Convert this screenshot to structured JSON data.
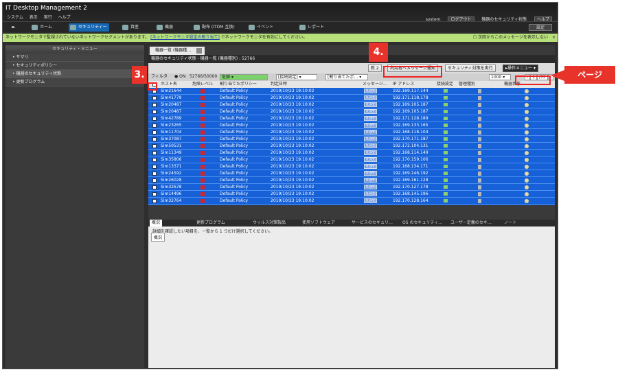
{
  "app": {
    "title": "IT Desktop Management 2",
    "menu": [
      "システム",
      "表示",
      "実行",
      "ヘルプ"
    ]
  },
  "topright": {
    "user": "system",
    "logout": "ログアウト",
    "status": "機器のセキュリティ状態",
    "help": "ヘルプ",
    "settings": "設定"
  },
  "nav": [
    "ホーム",
    "セキュリティー",
    "資産",
    "機器",
    "配布 (ITDM 互換)",
    "イベント",
    "レポート"
  ],
  "notice": {
    "text": "ネットワークモニタで監視されていないネットワークセグメントがあります。",
    "link": "[ネットワークモニタ設定の割り当て]",
    "tail": "でネットワークモニタを有効にしてください。",
    "checkbox": "次回からこのメッセージを表示しない",
    "close": "×"
  },
  "sidebar": {
    "title": "セキュリティ・メニュー",
    "items": [
      "サマリ",
      "セキュリティポリシー",
      "機器のセキュリティ状態",
      "更新プログラム"
    ]
  },
  "main": {
    "tab": "機器一覧 (機器種…",
    "breadcrumb": "機器のセキュリティ状態 - 機器一覧 (機器種別) : 52766",
    "toolbar": {
      "send_message": "利用者へメッセージ通知",
      "run_security": "セキュリティ対策を実行",
      "ops_menu": "操作メニュー",
      "cut": "新 2"
    },
    "filter": {
      "label": "フィルタ",
      "on": "ON",
      "count": "52766/50000",
      "danger": "危険",
      "connection": "[接続設定]",
      "policy": "[割り当てたポ…",
      "per_page": "1000",
      "page": "1",
      "total": "/53"
    },
    "columns": [
      "ホスト名",
      "危険レベル",
      "割り当てたポリシー",
      "判定日時",
      "メッセージ…",
      "IP アドレス",
      "接続設定",
      "管理種別",
      "機器状態"
    ],
    "rows": [
      [
        "Sim21644",
        "Default Policy",
        "2019/10/23 19:10:02",
        "未通知",
        "192.169.117.144"
      ],
      [
        "Sim41779",
        "Default Policy",
        "2019/10/23 19:10:02",
        "未通知",
        "192.171.118.178"
      ],
      [
        "Sim20487",
        "Default Policy",
        "2019/10/23 19:10:02",
        "未通知",
        "192.169.105.187"
      ],
      [
        "Sim20487",
        "Default Policy",
        "2019/10/23 19:10:02",
        "未通知",
        "192.169.105.187"
      ],
      [
        "Sim42789",
        "Default Policy",
        "2019/10/23 19:10:02",
        "未通知",
        "192.171.128.189"
      ],
      [
        "Sim23265",
        "Default Policy",
        "2019/10/23 19:10:02",
        "未通知",
        "192.169.133.165"
      ],
      [
        "Sim11704",
        "Default Policy",
        "2019/10/23 19:10:02",
        "未通知",
        "192.168.118.104"
      ],
      [
        "Sim37087",
        "Default Policy",
        "2019/10/23 19:10:02",
        "未通知",
        "192.170.171.187"
      ],
      [
        "Sim50531",
        "Default Policy",
        "2019/10/23 19:10:02",
        "未通知",
        "192.172.104.131"
      ],
      [
        "Sim11349",
        "Default Policy",
        "2019/10/23 19:10:02",
        "未通知",
        "192.168.114.149"
      ],
      [
        "Sim35806",
        "Default Policy",
        "2019/10/23 19:10:02",
        "未通知",
        "192.170.159.106"
      ],
      [
        "Sim13371",
        "Default Policy",
        "2019/10/23 19:10:02",
        "未通知",
        "192.168.134.171"
      ],
      [
        "Sim24592",
        "Default Policy",
        "2019/10/23 19:10:02",
        "未通知",
        "192.169.146.192"
      ],
      [
        "Sim26028",
        "Default Policy",
        "2019/10/23 19:10:02",
        "未通知",
        "192.169.161.128"
      ],
      [
        "Sim32678",
        "Default Policy",
        "2019/10/23 19:10:02",
        "未通知",
        "192.170.127.178"
      ],
      [
        "Sim14496",
        "Default Policy",
        "2019/10/23 19:10:02",
        "未通知",
        "192.168.145.196"
      ],
      [
        "Sim32764",
        "Default Policy",
        "2019/10/23 19:10:02",
        "未通知",
        "192.170.128.164"
      ]
    ],
    "bottom_tabs": [
      "概況",
      "更新プログラム",
      "ウィルス対策製品",
      "使用ソフトウェア",
      "サービスのセキュリ…",
      "OS のセキュリティ…",
      "ユーザー定義のセキ…",
      "ノート"
    ],
    "detail": {
      "message": "詳細を確認したい項目を、一覧から 1 つだけ選択してください。",
      "tab": "概況"
    }
  },
  "callouts": {
    "three": "3.",
    "four": "4.",
    "page": "ページ"
  },
  "colors": {
    "selection": "#1761d8",
    "callout": "#e8332b",
    "notice": "#b7e07a"
  }
}
